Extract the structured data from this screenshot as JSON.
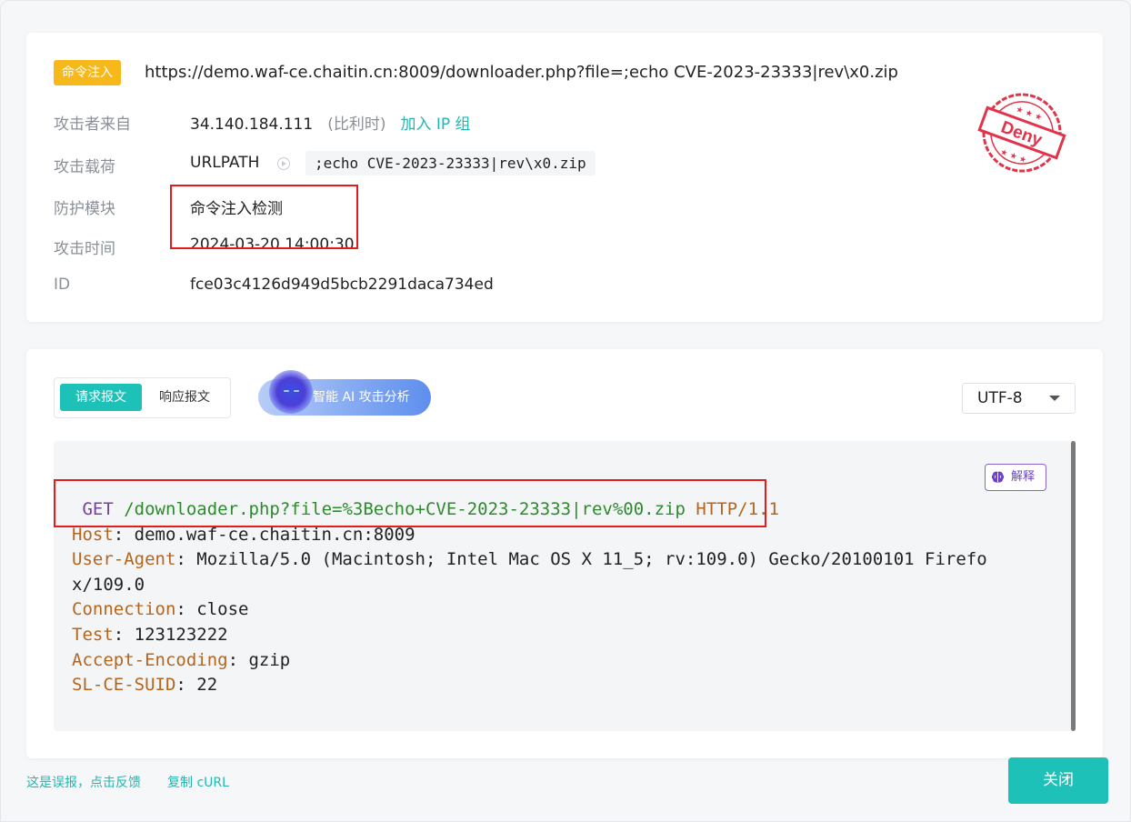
{
  "event": {
    "tag": "命令注入",
    "url": "https://demo.waf-ce.chaitin.cn:8009/downloader.php?file=;echo CVE-2023-23333|rev\\x0.zip",
    "stamp_text": "Deny",
    "fields": {
      "source_label": "攻击者来自",
      "source_ip": "34.140.184.111",
      "source_region": "(比利时)",
      "add_ip_group": "加入 IP 组",
      "payload_label": "攻击载荷",
      "payload_location": "URLPATH",
      "payload_value": ";echo CVE-2023-23333|rev\\x0.zip",
      "module_label": "防护模块",
      "module_value": "命令注入检测",
      "time_label": "攻击时间",
      "time_value": "2024-03-20 14:00:30",
      "id_label": "ID",
      "id_value": "fce03c4126d949d5bcb2291daca734ed"
    }
  },
  "message": {
    "tabs": {
      "request": "请求报文",
      "response": "响应报文"
    },
    "ai_button": "智能 AI 攻击分析",
    "encoding": "UTF-8",
    "explain_button": "解释",
    "request_line": {
      "method": "GET",
      "path": "/downloader.php?file=%3Becho+CVE-2023-23333|rev%00.zip",
      "protocol": "HTTP/1.1"
    },
    "headers": [
      {
        "key": "Host",
        "value": "demo.waf-ce.chaitin.cn:8009"
      },
      {
        "key": "User-Agent",
        "value": "Mozilla/5.0 (Macintosh; Intel Mac OS X 11_5; rv:109.0) Gecko/20100101 Firefo"
      },
      {
        "key": "",
        "value": "x/109.0"
      },
      {
        "key": "Connection",
        "value": "close"
      },
      {
        "key": "Test",
        "value": "123123222"
      },
      {
        "key": "Accept-Encoding",
        "value": "gzip"
      },
      {
        "key": "SL-CE-SUID",
        "value": "22"
      }
    ]
  },
  "footer": {
    "report_false_positive": "这是误报，点击反馈",
    "copy_curl": "复制 cURL",
    "close": "关闭"
  },
  "colors": {
    "accent": "#1ec1b8",
    "tag": "#f6b81b",
    "deny": "#e0344a",
    "highlight": "#e51c1c"
  }
}
